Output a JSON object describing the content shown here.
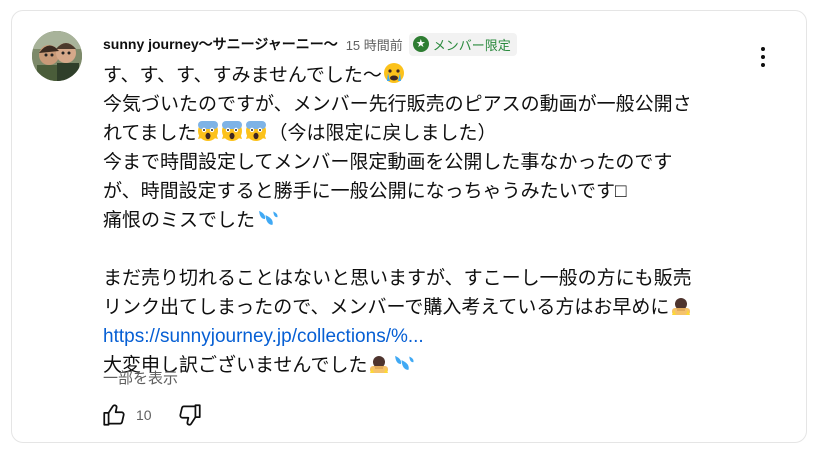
{
  "comment": {
    "author": "sunny journey〜サニージャーニー〜",
    "time": "15 時間前",
    "badge_label": "メンバー限定",
    "lines": [
      "す、す、す、すみませんでした〜",
      "今気づいたのですが、メンバー先行販売のピアスの動画が一般公開さ",
      "れてました",
      "（今は限定に戻しました）",
      "今まで時間設定してメンバー限定動画を公開した事なかったのです",
      "が、時間設定すると勝手に一般公開になっちゃうみたいです□",
      "痛恨のミスでした",
      "まだ売り切れることはないと思いますが、すこーし一般の方にも販売",
      "リンク出てしまったので、メンバーで購入考えている方はお早めに",
      "https://sunnyjourney.jp/collections/%...",
      "大変申し訳ございませんでした"
    ],
    "show_more": "一部を表示",
    "like_count": "10"
  },
  "icons": {
    "avatar": "avatar-photo",
    "badge": "member-star-icon",
    "menu": "more-vert-icon",
    "like": "thumbs-up-icon",
    "dislike": "thumbs-down-icon",
    "emoji_cry": "crying-face-emoji",
    "emoji_scream": "screaming-face-emoji",
    "emoji_sweat": "sweat-droplets-emoji",
    "emoji_bow": "bowing-person-emoji"
  },
  "colors": {
    "link": "#065fd4",
    "badge_text": "#2b8a3e",
    "badge_bg": "#f2f2f2",
    "secondary_text": "#606060"
  }
}
